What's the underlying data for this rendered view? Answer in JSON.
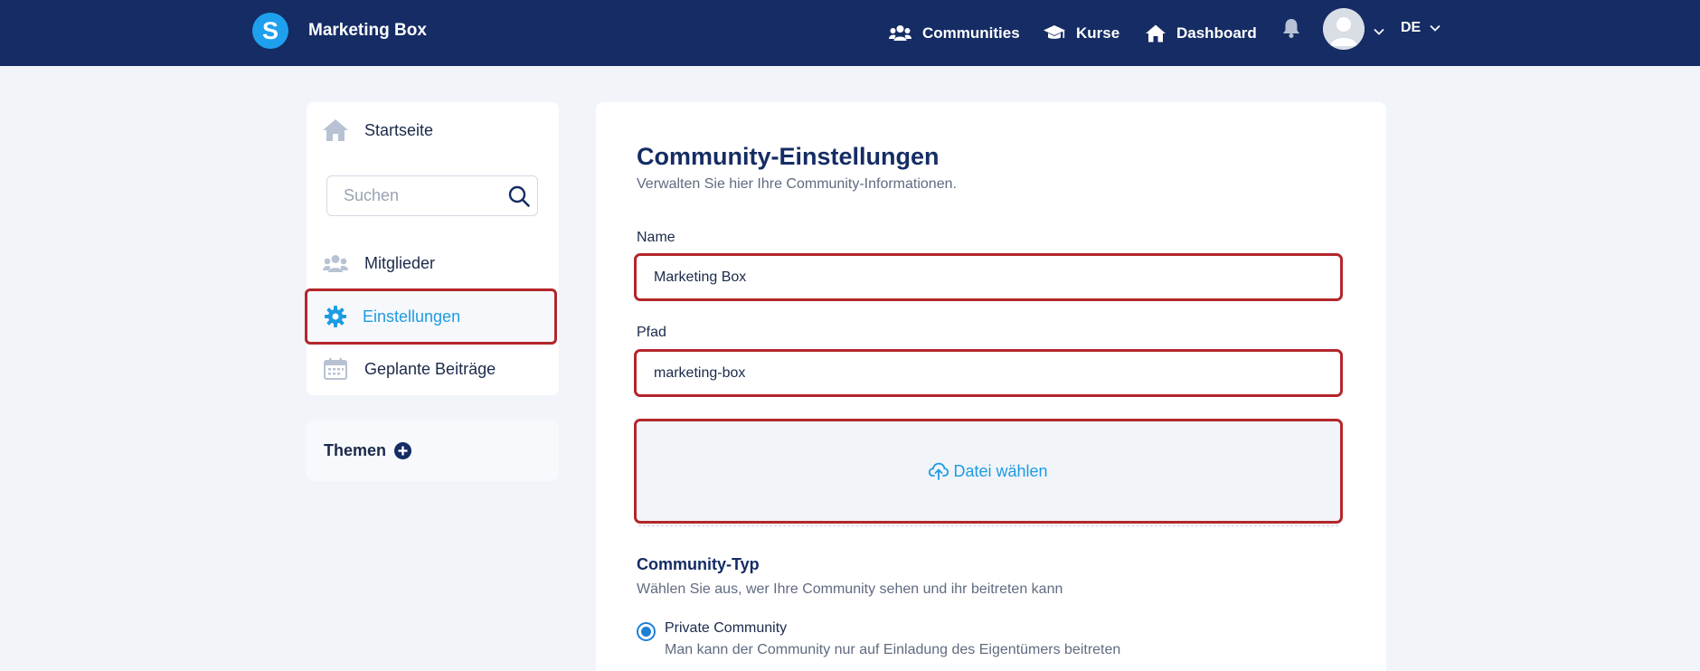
{
  "header": {
    "brand_letter": "S",
    "brand_name": "Marketing Box",
    "nav": {
      "communities": "Communities",
      "kurse": "Kurse",
      "dashboard": "Dashboard"
    },
    "language": "DE"
  },
  "sidebar": {
    "home": "Startseite",
    "search_placeholder": "Suchen",
    "members": "Mitglieder",
    "settings": "Einstellungen",
    "planned_posts": "Geplante Beiträge",
    "topics_title": "Themen"
  },
  "main": {
    "title": "Community-Einstellungen",
    "subtitle": "Verwalten Sie hier Ihre Community-Informationen.",
    "name_label": "Name",
    "name_value": "Marketing Box",
    "path_label": "Pfad",
    "path_value": "marketing-box",
    "upload_label": "Datei wählen",
    "type_title": "Community-Typ",
    "type_subtitle": "Wählen Sie aus, wer Ihre Community sehen und ihr beitreten kann",
    "private_label": "Private Community",
    "private_desc": "Man kann der Community nur auf Einladung des Eigentümers beitreten"
  },
  "colors": {
    "topbar": "#152c64",
    "brand_logo": "#1ea0ee",
    "accent": "#1d9be3",
    "highlight_border": "#b3262a",
    "radio": "#1d7fd6"
  },
  "icons": {
    "brand": "brand-logo-icon",
    "communities": "users-icon",
    "kurse": "graduation-cap-icon",
    "dashboard": "home-icon",
    "bell": "bell-icon",
    "avatar": "user-avatar-icon",
    "chevron": "chevron-down-icon",
    "search": "search-icon",
    "members": "users-icon",
    "settings": "gear-icon",
    "planned": "calendar-icon",
    "add": "plus-circle-icon",
    "upload": "cloud-upload-icon"
  }
}
